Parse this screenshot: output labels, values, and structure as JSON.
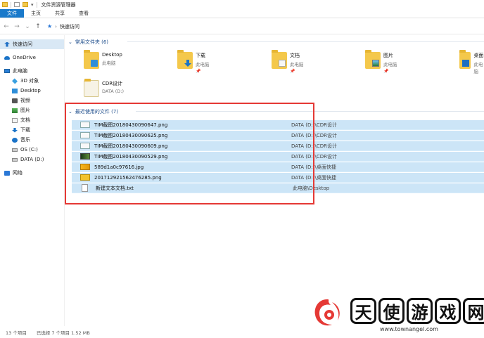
{
  "window": {
    "title": "文件资源管理器"
  },
  "ribbon": {
    "tabs": [
      "文件",
      "主页",
      "共享",
      "查看"
    ],
    "active": 0
  },
  "address": {
    "path": "快速访问"
  },
  "sidebar": {
    "items": [
      {
        "label": "快速访问",
        "icon": "pin-icon"
      },
      {
        "label": "OneDrive",
        "icon": "cloud-icon"
      },
      {
        "label": "此电脑",
        "icon": "computer-icon"
      },
      {
        "label": "3D 对象",
        "icon": "cube-icon"
      },
      {
        "label": "Desktop",
        "icon": "desktop-icon"
      },
      {
        "label": "视频",
        "icon": "video-icon"
      },
      {
        "label": "图片",
        "icon": "picture-icon"
      },
      {
        "label": "文档",
        "icon": "document-icon"
      },
      {
        "label": "下载",
        "icon": "download-icon"
      },
      {
        "label": "音乐",
        "icon": "music-icon"
      },
      {
        "label": "OS (C:)",
        "icon": "drive-icon"
      },
      {
        "label": "DATA (D:)",
        "icon": "drive-icon"
      },
      {
        "label": "网络",
        "icon": "network-icon"
      }
    ]
  },
  "frequent": {
    "header": "常用文件夹 (6)",
    "folders": [
      {
        "name": "Desktop",
        "location": "此电脑",
        "badge": "desk"
      },
      {
        "name": "下载",
        "location": "此电脑",
        "badge": "down"
      },
      {
        "name": "文档",
        "location": "此电脑",
        "badge": "doc"
      },
      {
        "name": "图片",
        "location": "此电脑",
        "badge": "pic"
      },
      {
        "name": "桌面",
        "location": "此电脑",
        "badge": "lib"
      },
      {
        "name": "CDR设计",
        "location": "DATA (D:)",
        "badge": "none"
      }
    ]
  },
  "recent": {
    "header": "最近使用的文件 (7)",
    "files": [
      {
        "name": "TIM截图20180430090647.png",
        "path": "DATA (D:)\\CDR设计",
        "thumb": "plain"
      },
      {
        "name": "TIM截图20180430090625.png",
        "path": "DATA (D:)\\CDR设计",
        "thumb": "plain"
      },
      {
        "name": "TIM截图20180430090609.png",
        "path": "DATA (D:)\\CDR设计",
        "thumb": "plain"
      },
      {
        "name": "TIM截图20180430090529.png",
        "path": "DATA (D:)\\CDR设计",
        "thumb": "dark"
      },
      {
        "name": "589d1a0c97616.jpg",
        "path": "DATA (D:)\\桌面快捷",
        "thumb": "warm"
      },
      {
        "name": "201712921562476285.png",
        "path": "DATA (D:)\\桌面快捷",
        "thumb": "yellow"
      },
      {
        "name": "新建文本文档.txt",
        "path": "此电脑\\Desktop",
        "thumb": "txt"
      }
    ]
  },
  "status": {
    "count": "13 个项目",
    "selected": "已选择 7 个项目 1.52 MB"
  },
  "watermark": {
    "chars": [
      "天",
      "使",
      "游",
      "戏",
      "网"
    ],
    "url": "www.townangel.com"
  },
  "colors": {
    "accent": "#1979ca",
    "selection": "#cce5f7",
    "highlight": "#e53935"
  }
}
